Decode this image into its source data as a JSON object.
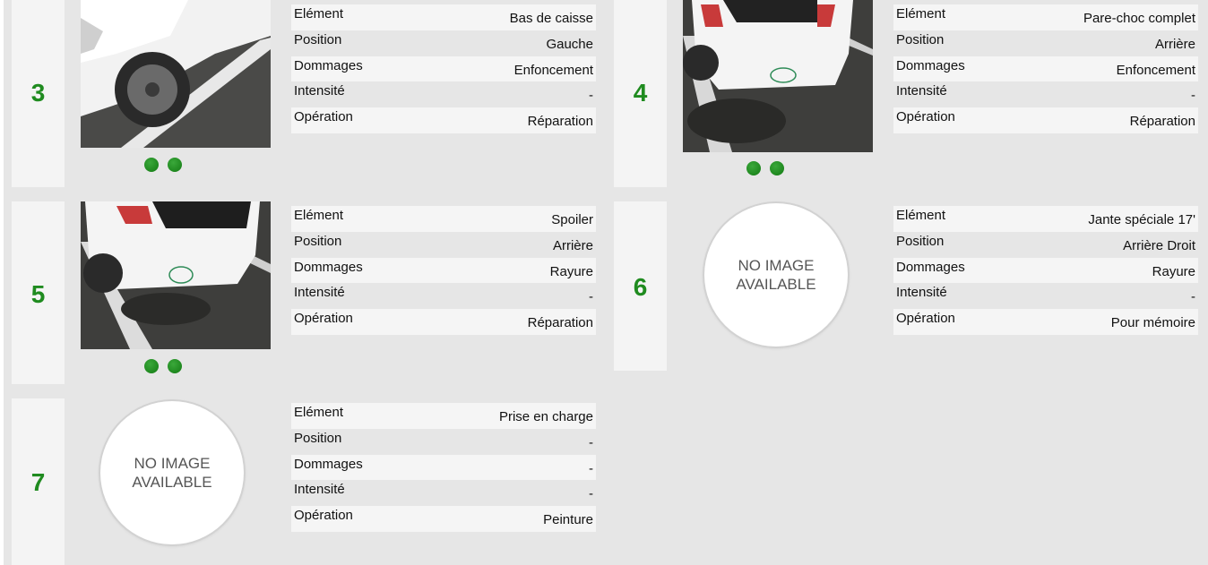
{
  "labels": {
    "element": "Elément",
    "position": "Position",
    "damage": "Dommages",
    "intensity": "Intensité",
    "operation": "Opération"
  },
  "no_image_text": "NO IMAGE AVAILABLE",
  "colors": {
    "accent_green": "#1f8b1f",
    "panel_bg": "#e6e6e6",
    "row_light": "#f5f5f5"
  },
  "items": [
    {
      "number": "3",
      "element": "Bas de caisse",
      "position": "Gauche",
      "damage": "Enfoncement",
      "intensity": "-",
      "operation": "Réparation",
      "has_photo": true,
      "photo_dots": 2
    },
    {
      "number": "4",
      "element": "Pare-choc complet",
      "position": "Arrière",
      "damage": "Enfoncement",
      "intensity": "-",
      "operation": "Réparation",
      "has_photo": true,
      "photo_dots": 2
    },
    {
      "number": "5",
      "element": "Spoiler",
      "position": "Arrière",
      "damage": "Rayure",
      "intensity": "-",
      "operation": "Réparation",
      "has_photo": true,
      "photo_dots": 2
    },
    {
      "number": "6",
      "element": "Jante spéciale 17'",
      "position": "Arrière Droit",
      "damage": "Rayure",
      "intensity": "-",
      "operation": "Pour mémoire",
      "has_photo": false,
      "photo_dots": 0
    },
    {
      "number": "7",
      "element": "Prise en charge",
      "position": "-",
      "damage": "-",
      "intensity": "-",
      "operation": "Peinture",
      "has_photo": false,
      "photo_dots": 0
    }
  ]
}
